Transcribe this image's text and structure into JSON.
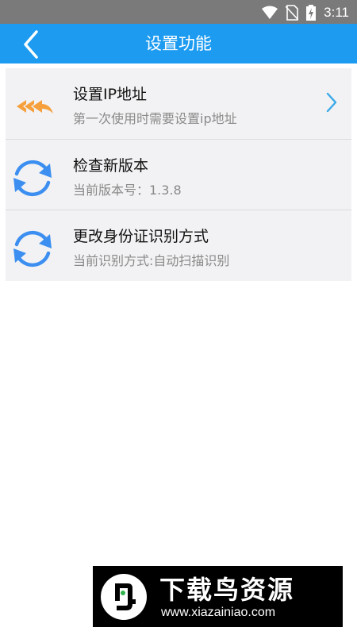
{
  "status_bar": {
    "time": "3:11",
    "icons": [
      "wifi-icon",
      "no-sim-icon",
      "battery-charging-icon"
    ]
  },
  "header": {
    "title": "设置功能",
    "back_icon": "chevron-left-icon",
    "background": "#1c9bf0"
  },
  "settings": {
    "items": [
      {
        "title": "设置IP地址",
        "subtitle": "第一次使用时需要设置ip地址",
        "icon": "reply-all-icon",
        "icon_color": "#f5a03c",
        "has_chevron": true
      },
      {
        "title": "检查新版本",
        "subtitle": "当前版本号：1.3.8",
        "icon": "refresh-icon",
        "icon_color": "#3c8ff0",
        "has_chevron": false
      },
      {
        "title": "更改身份证识别方式",
        "subtitle": "当前识别方式:自动扫描识别",
        "icon": "refresh-icon",
        "icon_color": "#3c8ff0",
        "has_chevron": false
      }
    ]
  },
  "watermark": {
    "brand": "下载鸟资源",
    "url": "www.xiazainiao.com"
  }
}
